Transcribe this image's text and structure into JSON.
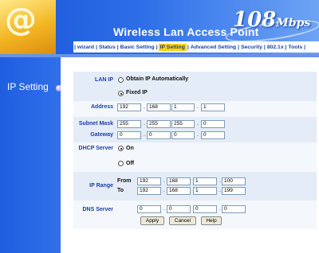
{
  "banner": {
    "title": "Wireless Lan Access Point",
    "speed": "108",
    "speed_unit": "Mbps",
    "logo_symbol": "@"
  },
  "nav": {
    "items": [
      "wizard",
      "Status",
      "Basic Setting",
      "IP Setting",
      "Advanced Setting",
      "Security",
      "802.1x",
      "Tools"
    ],
    "active": "IP Setting"
  },
  "sidebar": {
    "title": "IP Setting"
  },
  "form": {
    "lan_ip": {
      "label": "LAN IP",
      "option_auto": "Obtain IP Automatically",
      "option_fixed": "Fixed IP",
      "selected": "Fixed IP"
    },
    "address": {
      "label": "Address",
      "octets": [
        "192",
        "168",
        "1",
        "1"
      ]
    },
    "subnet_mask": {
      "label": "Subnet Mask",
      "octets": [
        "255",
        "255",
        "255",
        "0"
      ]
    },
    "gateway": {
      "label": "Gateway",
      "octets": [
        "0",
        "0",
        "0",
        "0"
      ]
    },
    "dhcp_server": {
      "label": "DHCP Server",
      "option_on": "On",
      "option_off": "Off",
      "selected": "On"
    },
    "ip_range": {
      "label": "IP Range",
      "from_label": "From",
      "to_label": "To",
      "from": [
        "192",
        "168",
        "1",
        "100"
      ],
      "to": [
        "192",
        "168",
        "1",
        "199"
      ]
    },
    "dns_server": {
      "label": "DNS Server",
      "octets": [
        "0",
        "0",
        "0",
        "0"
      ]
    }
  },
  "buttons": {
    "apply": "Apply",
    "cancel": "Cancel",
    "help": "Help"
  },
  "colors": {
    "sidebar": "#1f5ee0",
    "accent": "#ffd400",
    "label": "#1a3ea8",
    "band": "#e4ecf7"
  }
}
